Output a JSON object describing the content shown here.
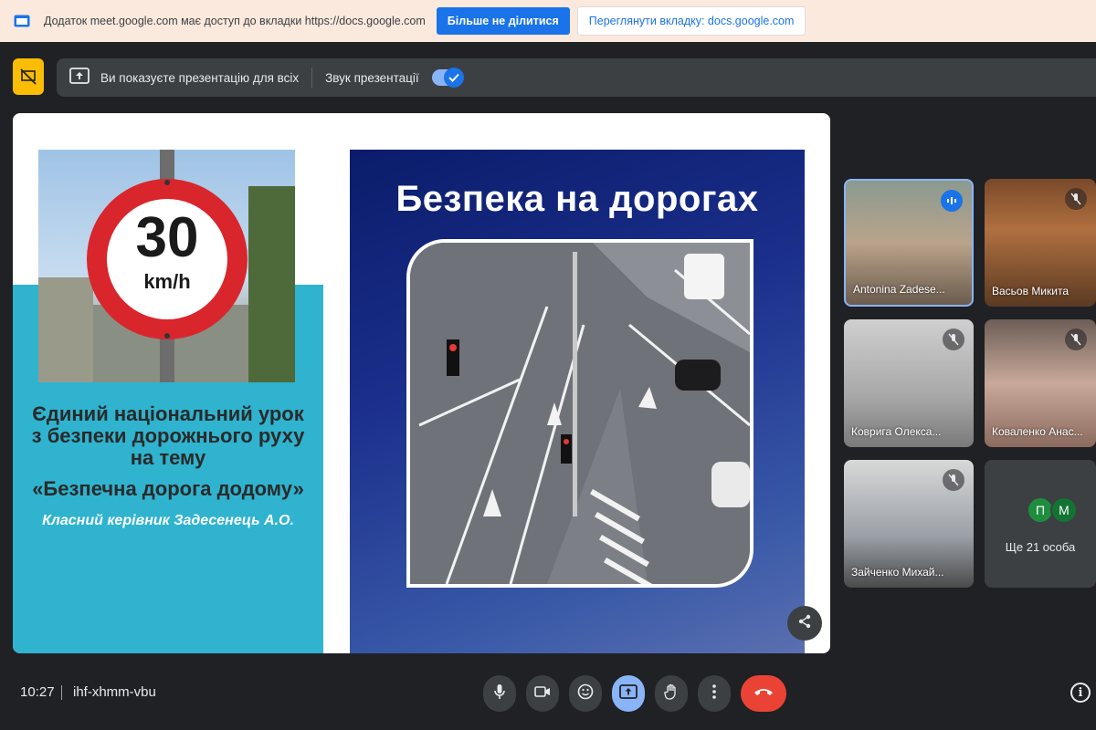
{
  "share_banner": {
    "message": "Додаток meet.google.com має доступ до вкладки https://docs.google.com",
    "stop_label": "Більше не ділитися",
    "view_tab_label": "Переглянути вкладку: docs.google.com"
  },
  "presenting_bar": {
    "presenting_text": "Ви показуєте презентацію для всіх",
    "audio_label": "Звук презентації",
    "audio_enabled": true
  },
  "slide": {
    "left": {
      "speed_limit": "30",
      "speed_unit": "km/h",
      "heading": "Єдиний національний урок з безпеки дорожнього руху на тему",
      "subtitle": "«Безпечна дорога додому»",
      "author": "Класний керівник  Задесенець А.О."
    },
    "right": {
      "title": "Безпека на дорогах"
    }
  },
  "participants": [
    {
      "name": "Antonina Zadese...",
      "speaking": true
    },
    {
      "name": "Васьов Микита",
      "muted": true
    },
    {
      "name": "Коврига Олекса...",
      "muted": true
    },
    {
      "name": "Коваленко Анас...",
      "muted": true
    },
    {
      "name": "Зайченко Михай...",
      "muted": true
    }
  ],
  "more_tile": {
    "avatar1": "П",
    "avatar2": "M",
    "label": "Ще 21 особа"
  },
  "bottom_bar": {
    "time": "10:27",
    "meeting_code": "ihf-xhmm-vbu"
  },
  "colors": {
    "accent": "#1a73e8",
    "end_call": "#ea4335",
    "present_active": "#8ab4f8",
    "presenter_badge": "#fbbc04",
    "slide_cyan": "#2fb3cf",
    "slide_navy": "#0a1c6a"
  }
}
